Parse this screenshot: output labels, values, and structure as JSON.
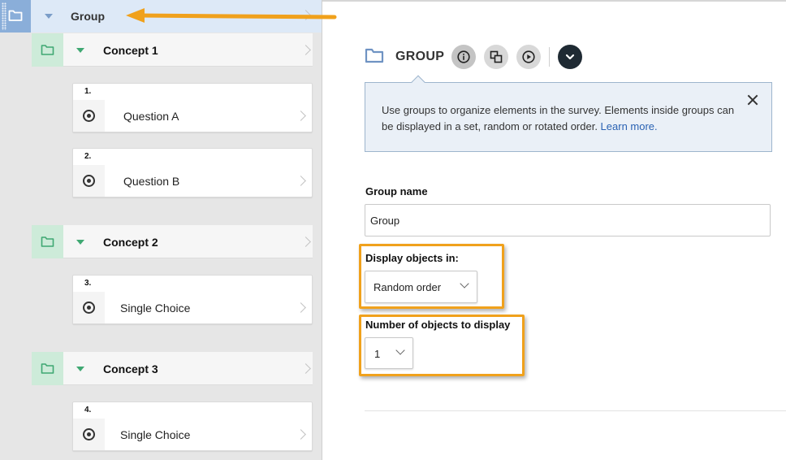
{
  "tree": {
    "group": {
      "label": "Group"
    },
    "concepts": [
      {
        "label": "Concept 1",
        "questions": [
          {
            "number": "1.",
            "label": "Question A"
          },
          {
            "number": "2.",
            "label": "Question B"
          }
        ]
      },
      {
        "label": "Concept 2",
        "questions": [
          {
            "number": "3.",
            "label": "Single Choice"
          }
        ]
      },
      {
        "label": "Concept 3",
        "questions": [
          {
            "number": "4.",
            "label": "Single Choice"
          }
        ]
      }
    ]
  },
  "editor": {
    "title": "GROUP",
    "toolbar_icons": [
      "info-icon",
      "copy-icon",
      "preview-icon",
      "more-options-icon"
    ],
    "info": {
      "text": "Use groups to organize elements in the survey. Elements inside groups can be displayed in a set, random or rotated order. ",
      "link": "Learn more."
    },
    "group_name": {
      "label": "Group name",
      "value": "Group"
    },
    "display_objects": {
      "label": "Display objects in:",
      "value": "Random order"
    },
    "num_objects": {
      "label": "Number of objects to display",
      "value": "1"
    }
  },
  "colors": {
    "accent_highlight": "#f0a11c",
    "group_icon_bg": "#8aaed9",
    "concept_icon_bg": "#cdebd9",
    "link": "#2a62b3"
  }
}
